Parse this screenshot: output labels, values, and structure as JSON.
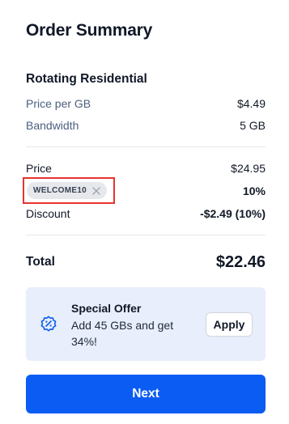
{
  "summary": {
    "title": "Order Summary",
    "product": "Rotating Residential",
    "price_per_gb_label": "Price per GB",
    "price_per_gb_value": "$4.49",
    "bandwidth_label": "Bandwidth",
    "bandwidth_value": "5 GB",
    "price_label": "Price",
    "price_value": "$24.95",
    "coupon_code": "WELCOME10",
    "coupon_percent": "10%",
    "discount_label": "Discount",
    "discount_value": "-$2.49 (10%)",
    "total_label": "Total",
    "total_value": "$22.46"
  },
  "offer": {
    "title": "Special Offer",
    "text": "Add 45 GBs and get 34%!",
    "button": "Apply",
    "icon": "discount-badge-icon"
  },
  "footer": {
    "next_label": "Next"
  },
  "colors": {
    "accent": "#0b5cf2",
    "offer_bg": "#e8eefb",
    "highlight": "#e8332e",
    "muted_text": "#4b5f7e"
  }
}
